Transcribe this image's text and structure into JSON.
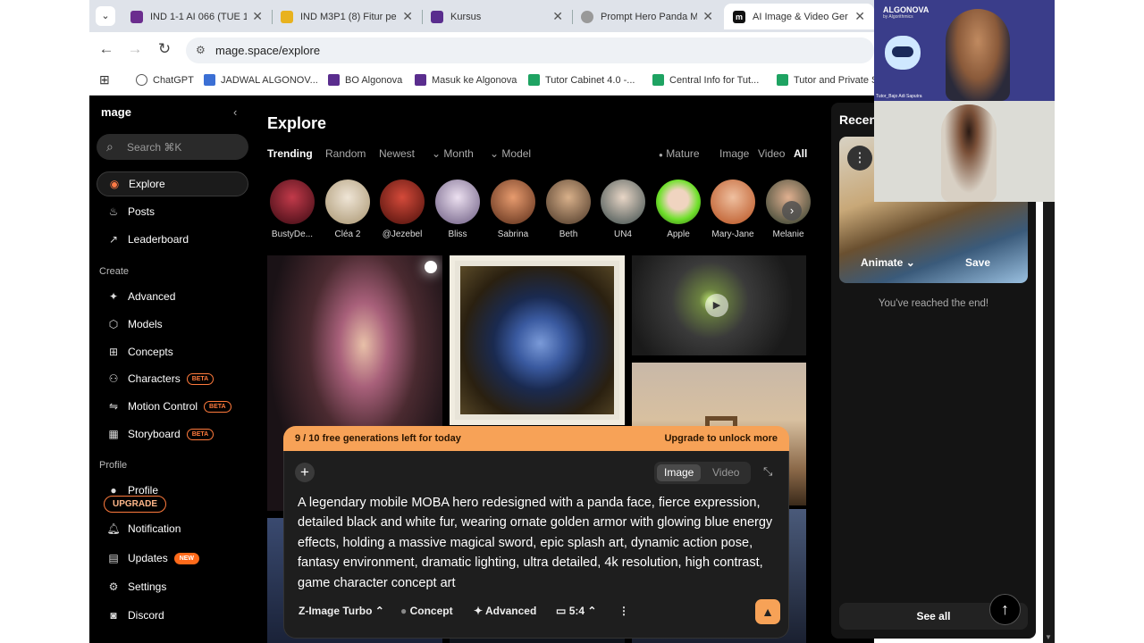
{
  "browser": {
    "tabs": [
      {
        "title": "IND 1-1 AI 066 (TUE 1",
        "favicon_color": "#6b2d8e"
      },
      {
        "title": "IND M3P1 (8) Fitur pe",
        "favicon_color": "#e8b21e"
      },
      {
        "title": "Kursus",
        "favicon_color": "#5a2d8e"
      },
      {
        "title": "Prompt Hero Panda M",
        "favicon_color": "#777777"
      },
      {
        "title": "AI Image & Video Ger",
        "favicon_color": "#111111"
      }
    ],
    "url": "mage.space/explore",
    "bookmarks": [
      {
        "label": "ChatGPT",
        "color": "#333333"
      },
      {
        "label": "JADWAL ALGONOV...",
        "color": "#3b6fd4"
      },
      {
        "label": "BO Algonova",
        "color": "#5a2d8e"
      },
      {
        "label": "Masuk ke Algonova",
        "color": "#5a2d8e"
      },
      {
        "label": "Tutor Cabinet 4.0 -...",
        "color": "#1ea362"
      },
      {
        "label": "Central Info for Tut...",
        "color": "#1ea362"
      },
      {
        "label": "Tutor and Private S",
        "color": "#1ea362"
      }
    ]
  },
  "sidebar": {
    "logo": "mage",
    "search_placeholder": "Search",
    "search_shortcut": "⌘K",
    "nav": [
      {
        "label": "Explore",
        "icon": "compass-icon",
        "active": true
      },
      {
        "label": "Posts",
        "icon": "flame-icon"
      },
      {
        "label": "Leaderboard",
        "icon": "trending-icon"
      }
    ],
    "create_title": "Create",
    "create": [
      {
        "label": "Advanced",
        "icon": "sparkles-icon"
      },
      {
        "label": "Models",
        "icon": "cube-icon"
      },
      {
        "label": "Concepts",
        "icon": "grid-icon"
      },
      {
        "label": "Characters",
        "icon": "users-icon",
        "badge": "BETA"
      },
      {
        "label": "Motion Control",
        "icon": "motion-icon",
        "badge": "BETA"
      },
      {
        "label": "Storyboard",
        "icon": "film-icon",
        "badge": "BETA"
      }
    ],
    "profile_title": "Profile",
    "profile": [
      {
        "label": "Profile",
        "icon": "user-icon"
      },
      {
        "label": "Notification",
        "icon": "bell-icon"
      },
      {
        "label": "Updates",
        "icon": "news-icon",
        "badge": "NEW"
      },
      {
        "label": "Settings",
        "icon": "gear-icon"
      },
      {
        "label": "Discord",
        "icon": "discord-icon"
      }
    ],
    "upgrade_label": "UPGRADE"
  },
  "explore": {
    "title": "Explore",
    "sort_tabs": [
      "Trending",
      "Random",
      "Newest"
    ],
    "month_label": "Month",
    "model_label": "Model",
    "mature_label": "Mature",
    "type_tabs": [
      "Image",
      "Video",
      "All"
    ],
    "characters": [
      "BustyDe...",
      "Cléa 2",
      "@Jezebel",
      "Bliss",
      "Sabrina",
      "Beth",
      "UN4",
      "Apple",
      "Mary-Jane",
      "Melanie"
    ]
  },
  "composer": {
    "promo_left": "9 / 10 free generations left for today",
    "promo_right": "Upgrade to unlock more",
    "mode_image": "Image",
    "mode_video": "Video",
    "prompt": "A legendary mobile MOBA hero redesigned with a panda face, fierce expression, detailed black and white fur, wearing ornate golden armor with glowing blue energy effects, holding a massive magical sword, epic splash art, dynamic action pose, fantasy environment, dramatic lighting, ultra detailed, 4k resolution, high contrast, game character concept art",
    "model": "Z-Image Turbo",
    "concept": "Concept",
    "advanced": "Advanced",
    "ratio": "5:4"
  },
  "recent": {
    "title": "Recen",
    "animate": "Animate",
    "save": "Save",
    "end_text": "You've reached the end!",
    "see_all": "See all"
  },
  "overlay": {
    "brand": "ALGONOVA",
    "brand_sub": "by Algorithmics",
    "tutor_name": "Tutor_Bajo Adi Saputra"
  }
}
